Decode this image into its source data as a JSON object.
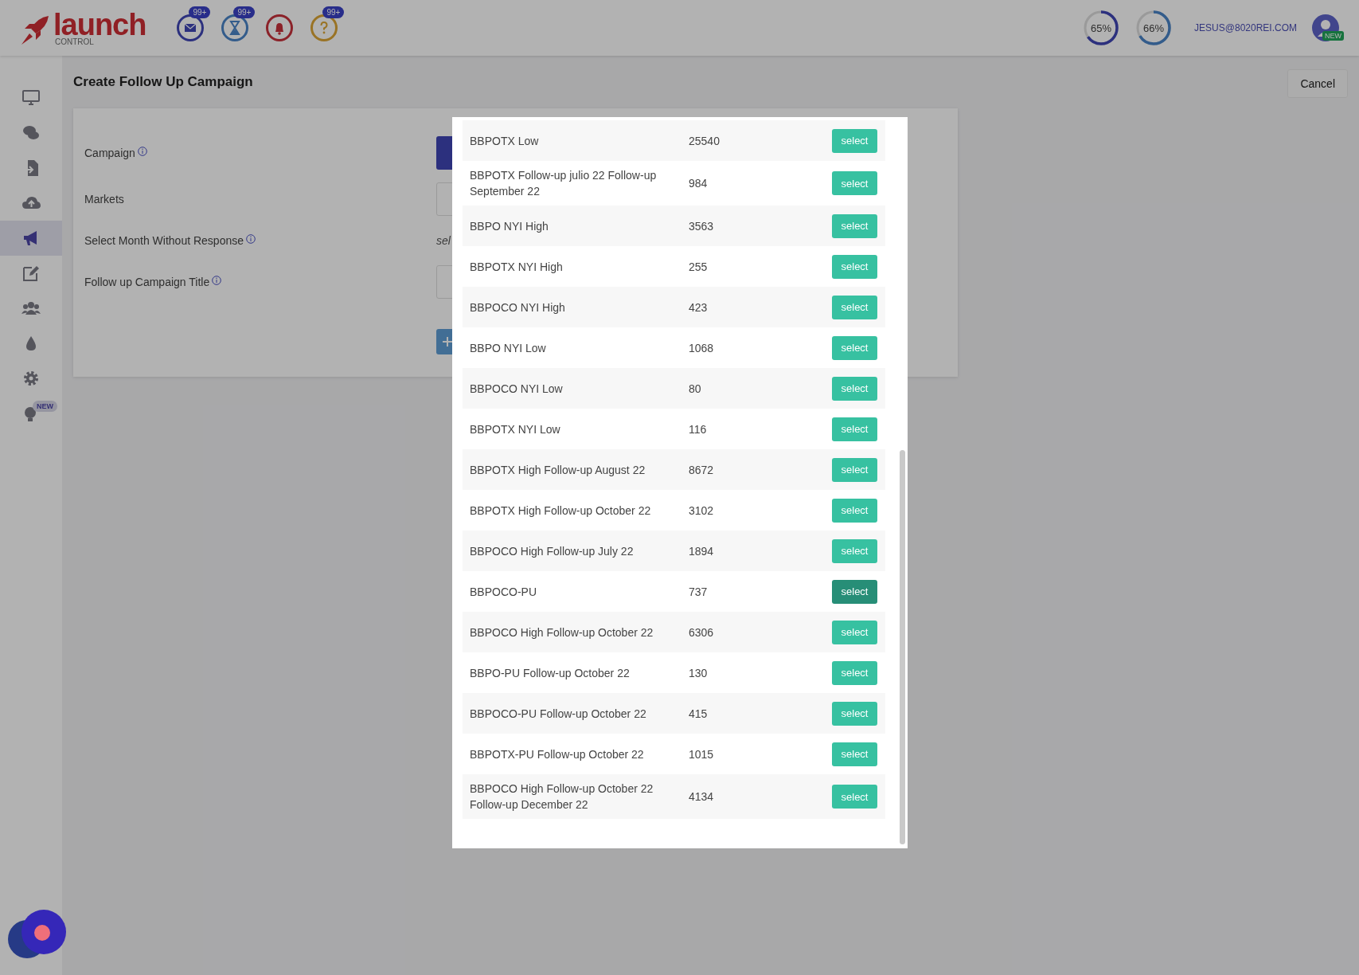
{
  "header": {
    "logo": {
      "name": "launch",
      "tagline": "CONTROL"
    },
    "notifications": [
      {
        "kind": "mail",
        "badge": "99+"
      },
      {
        "kind": "hourglass",
        "badge": "99+"
      },
      {
        "kind": "bell"
      },
      {
        "kind": "help",
        "badge": "99+"
      }
    ],
    "meters": [
      {
        "reading": "65%",
        "level": 0.65
      },
      {
        "reading": "66%",
        "level": 0.66
      }
    ],
    "user": {
      "email": "JESUS@8020REI.COM",
      "badge": "NEW"
    }
  },
  "sidebar": {
    "items": [
      {
        "kind": "monitor",
        "selected": false
      },
      {
        "kind": "chat",
        "selected": false
      },
      {
        "kind": "import",
        "selected": false
      },
      {
        "kind": "upload",
        "selected": false
      },
      {
        "kind": "megaphone",
        "selected": true
      },
      {
        "kind": "edit",
        "selected": false
      },
      {
        "kind": "users",
        "selected": false
      },
      {
        "kind": "drop",
        "selected": false
      },
      {
        "kind": "gear",
        "selected": false
      },
      {
        "kind": "bulb",
        "selected": false,
        "badge": "NEW"
      }
    ]
  },
  "page": {
    "title": "Create Follow Up Campaign",
    "cancel": "Cancel"
  },
  "form": {
    "fields": [
      {
        "label": "Campaign",
        "info": true,
        "kind": "button"
      },
      {
        "label": "Markets",
        "info": false,
        "kind": "input"
      },
      {
        "label": "Select Month Without Response",
        "info": true,
        "kind": "text",
        "value": "sel"
      },
      {
        "label": "Follow up Campaign Title",
        "info": true,
        "kind": "input"
      }
    ]
  },
  "modal": {
    "rows": [
      {
        "name": "BBPOTX Low",
        "count": "25540",
        "button": "select",
        "selected": false
      },
      {
        "name": "BBPOTX Follow-up julio 22 Follow-up September 22",
        "count": "984",
        "button": "select",
        "selected": false
      },
      {
        "name": "BBPO NYI High",
        "count": "3563",
        "button": "select",
        "selected": false
      },
      {
        "name": "BBPOTX NYI High",
        "count": "255",
        "button": "select",
        "selected": false
      },
      {
        "name": "BBPOCO NYI High",
        "count": "423",
        "button": "select",
        "selected": false
      },
      {
        "name": "BBPO NYI Low",
        "count": "1068",
        "button": "select",
        "selected": false
      },
      {
        "name": "BBPOCO NYI Low",
        "count": "80",
        "button": "select",
        "selected": false
      },
      {
        "name": "BBPOTX NYI Low",
        "count": "116",
        "button": "select",
        "selected": false
      },
      {
        "name": "BBPOTX High Follow-up August 22",
        "count": "8672",
        "button": "select",
        "selected": false
      },
      {
        "name": "BBPOTX High Follow-up October 22",
        "count": "3102",
        "button": "select",
        "selected": false
      },
      {
        "name": "BBPOCO High Follow-up July 22",
        "count": "1894",
        "button": "select",
        "selected": false
      },
      {
        "name": "BBPOCO-PU",
        "count": "737",
        "button": "select",
        "selected": true
      },
      {
        "name": "BBPOCO High Follow-up October 22",
        "count": "6306",
        "button": "select",
        "selected": false
      },
      {
        "name": "BBPO-PU Follow-up October 22",
        "count": "130",
        "button": "select",
        "selected": false
      },
      {
        "name": "BBPOCO-PU Follow-up October 22",
        "count": "415",
        "button": "select",
        "selected": false
      },
      {
        "name": "BBPOTX-PU Follow-up October 22",
        "count": "1015",
        "button": "select",
        "selected": false
      },
      {
        "name": "BBPOCO High Follow-up October 22 Follow-up December 22",
        "count": "4134",
        "button": "select",
        "selected": false
      }
    ]
  }
}
